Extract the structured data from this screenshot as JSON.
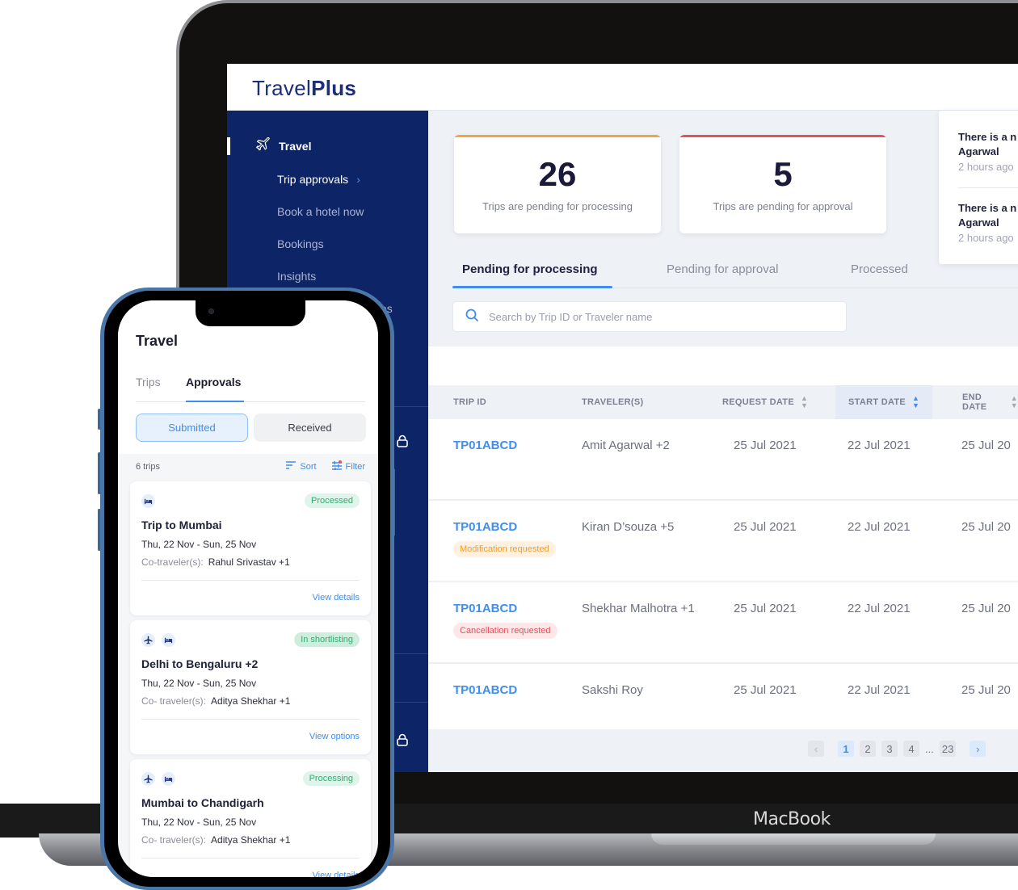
{
  "device_label": "MacBook",
  "app": {
    "logo_light": "Travel",
    "logo_bold": "Plus"
  },
  "sidebar": {
    "section": {
      "label": "Travel",
      "icon": "airplane-icon"
    },
    "items": [
      {
        "label": "Trip approvals",
        "active": true,
        "icon": "chevron-right-icon"
      },
      {
        "label": "Book a hotel now",
        "active": false
      },
      {
        "label": "Bookings",
        "active": false
      },
      {
        "label": "Insights",
        "active": false
      },
      {
        "label": "es",
        "active": false
      }
    ],
    "lock_icons": [
      "lock-icon",
      "lock-icon"
    ]
  },
  "stats": [
    {
      "value": "26",
      "label": "Trips are pending for processing",
      "accent": "#f6a33b"
    },
    {
      "value": "5",
      "label": "Trips are pending for approval",
      "accent": "#e0545c"
    }
  ],
  "notifications": [
    {
      "title_line1": "There is a n",
      "title_line2": "Agarwal",
      "time": "2 hours ago"
    },
    {
      "title_line1": "There is a n",
      "title_line2": "Agarwal",
      "time": "2 hours ago"
    }
  ],
  "tabs": [
    {
      "label": "Pending for processing",
      "active": true
    },
    {
      "label": "Pending for approval",
      "active": false
    },
    {
      "label": "Processed",
      "active": false
    }
  ],
  "search": {
    "placeholder": "Search by Trip ID or Traveler name",
    "value": ""
  },
  "table": {
    "columns": [
      {
        "label": "TRIP ID",
        "sortable": false
      },
      {
        "label": "TRAVELER(S)",
        "sortable": false
      },
      {
        "label": "REQUEST DATE",
        "sortable": true
      },
      {
        "label": "START DATE",
        "sortable": true,
        "sorted": true
      },
      {
        "label": "END DATE",
        "sortable": true
      }
    ],
    "rows": [
      {
        "trip_id": "TP01ABCD",
        "travelers": "Amit Agarwal +2",
        "request_date": "25 Jul 2021",
        "start_date": "22 Jul 2021",
        "end_date": "25 Jul 20",
        "status": null
      },
      {
        "trip_id": "TP01ABCD",
        "travelers": "Kiran D’souza +5",
        "request_date": "25 Jul 2021",
        "start_date": "22 Jul 2021",
        "end_date": "25 Jul 20",
        "status": {
          "label": "Modification requested",
          "kind": "mod"
        }
      },
      {
        "trip_id": "TP01ABCD",
        "travelers": "Shekhar Malhotra +1",
        "request_date": "25 Jul 2021",
        "start_date": "22 Jul 2021",
        "end_date": "25 Jul 20",
        "status": {
          "label": "Cancellation requested",
          "kind": "cancel"
        }
      },
      {
        "trip_id": "TP01ABCD",
        "travelers": "Sakshi Roy",
        "request_date": "25 Jul 2021",
        "start_date": "22 Jul 2021",
        "end_date": "25 Jul 20",
        "status": null
      }
    ]
  },
  "pagination": {
    "prev": "‹",
    "pages": [
      "1",
      "2",
      "3",
      "4"
    ],
    "ellipsis": "...",
    "last": "23",
    "current": "1",
    "next": "›"
  },
  "phone": {
    "title": "Travel",
    "tabs": [
      {
        "label": "Trips",
        "active": false
      },
      {
        "label": "Approvals",
        "active": true
      }
    ],
    "segments": [
      {
        "label": "Submitted",
        "active": true
      },
      {
        "label": "Received",
        "active": false
      }
    ],
    "count": "6 trips",
    "sort_label": "Sort",
    "filter_label": "Filter",
    "trips": [
      {
        "icons": [
          "hotel-icon"
        ],
        "status": "Processed",
        "title": "Trip to Mumbai",
        "dates": "Thu, 22 Nov - Sun, 25 Nov",
        "co_label": "Co-traveler(s):",
        "co_value": "Rahul Srivastav +1",
        "link": "View details"
      },
      {
        "icons": [
          "flight-icon",
          "hotel-icon"
        ],
        "status": "In shortlisting",
        "title": "Delhi to Bengaluru +2",
        "dates": "Thu, 22 Nov - Sun, 25 Nov",
        "co_label": "Co- traveler(s):",
        "co_value": "Aditya Shekhar +1",
        "link": "View options"
      },
      {
        "icons": [
          "flight-icon",
          "hotel-icon"
        ],
        "status": "Processing",
        "title": "Mumbai to Chandigarh",
        "dates": "Thu, 22 Nov - Sun, 25 Nov",
        "co_label": "Co- traveler(s):",
        "co_value": "Aditya Shekhar +1",
        "link": "View details"
      }
    ]
  },
  "colors": {
    "brand_navy": "#0d2567",
    "accent_blue": "#3e8ef0",
    "processing_orange": "#f6a33b",
    "approval_red": "#e0545c",
    "status_green": "#2fae6e"
  }
}
